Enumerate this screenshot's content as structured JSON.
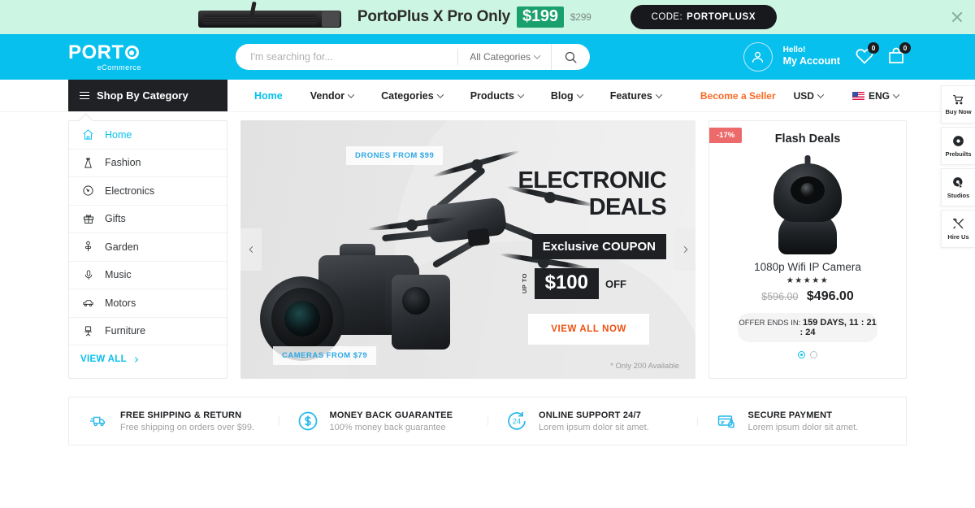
{
  "promo": {
    "headline": "PortoPlus X Pro Only",
    "price": "$199",
    "old_price": "$299",
    "code_label": "CODE:",
    "code_value": "PORTOPLUSX",
    "close_icon": "close-icon",
    "bg_color": "#cdf5e3",
    "price_bg": "#1aa06d"
  },
  "header": {
    "logo_main": "PORT",
    "logo_sub": "eCommerce",
    "accent_color": "#08c0ee",
    "search": {
      "placeholder": "I'm searching for...",
      "value": "",
      "category_label": "All Categories",
      "search_icon": "search-icon"
    },
    "account": {
      "greeting": "Hello!",
      "label": "My Account",
      "avatar_icon": "user-icon"
    },
    "wishlist": {
      "icon": "heart-icon",
      "count": "0"
    },
    "cart": {
      "icon": "bag-icon",
      "count": "0"
    }
  },
  "nav": {
    "shop_by_category": "Shop By Category",
    "items": [
      {
        "label": "Home",
        "active": true,
        "caret": false
      },
      {
        "label": "Vendor",
        "active": false,
        "caret": true
      },
      {
        "label": "Categories",
        "active": false,
        "caret": true
      },
      {
        "label": "Products",
        "active": false,
        "caret": true
      },
      {
        "label": "Blog",
        "active": false,
        "caret": true
      },
      {
        "label": "Features",
        "active": false,
        "caret": true
      }
    ],
    "become_seller": "Become a Seller",
    "currency": "USD",
    "language": "ENG",
    "seller_color": "#f96a24"
  },
  "sidebar": {
    "items": [
      {
        "label": "Home",
        "icon": "home-icon",
        "active": true
      },
      {
        "label": "Fashion",
        "icon": "dress-icon",
        "active": false
      },
      {
        "label": "Electronics",
        "icon": "gauge-icon",
        "active": false
      },
      {
        "label": "Gifts",
        "icon": "gift-icon",
        "active": false
      },
      {
        "label": "Garden",
        "icon": "plant-icon",
        "active": false
      },
      {
        "label": "Music",
        "icon": "microphone-icon",
        "active": false
      },
      {
        "label": "Motors",
        "icon": "car-icon",
        "active": false
      },
      {
        "label": "Furniture",
        "icon": "chair-icon",
        "active": false
      }
    ],
    "view_all": "VIEW ALL"
  },
  "hero": {
    "tag_drones": "DRONES FROM $99",
    "tag_cameras": "CAMERAS FROM $79",
    "title_line1": "ELECTRONIC",
    "title_line2": "DEALS",
    "coupon_band": "Exclusive COUPON",
    "up_to": "UP TO",
    "amount": "$100",
    "off": "OFF",
    "cta": "VIEW ALL NOW",
    "note": "* Only 200 Available",
    "prev_icon": "chevron-left-icon",
    "next_icon": "chevron-right-icon"
  },
  "flash": {
    "badge": "-17%",
    "title": "Flash Deals",
    "product_name": "1080p Wifi IP Camera",
    "rating": "★★★★★",
    "price_old": "$596.00",
    "price_new": "$496.00",
    "offer_label": "OFFER ENDS IN:",
    "offer_time": "159 DAYS, 11 : 21 : 24",
    "badge_color": "#ec6a6a"
  },
  "features": [
    {
      "icon": "truck-icon",
      "title": "FREE SHIPPING & RETURN",
      "sub": "Free shipping on orders over $99."
    },
    {
      "icon": "dollar-circle-icon",
      "title": "MONEY BACK GUARANTEE",
      "sub": "100% money back guarantee"
    },
    {
      "icon": "support-24-icon",
      "title": "ONLINE SUPPORT 24/7",
      "sub": "Lorem ipsum dolor sit amet."
    },
    {
      "icon": "secure-card-icon",
      "title": "SECURE PAYMENT",
      "sub": "Lorem ipsum dolor sit amet."
    }
  ],
  "floatbar": [
    {
      "label": "Buy Now",
      "icon": "cart-icon"
    },
    {
      "label": "Prebuilts",
      "icon": "disc-icon"
    },
    {
      "label": "Studios",
      "icon": "cursor-target-icon"
    },
    {
      "label": "Hire Us",
      "icon": "tools-icon"
    }
  ]
}
